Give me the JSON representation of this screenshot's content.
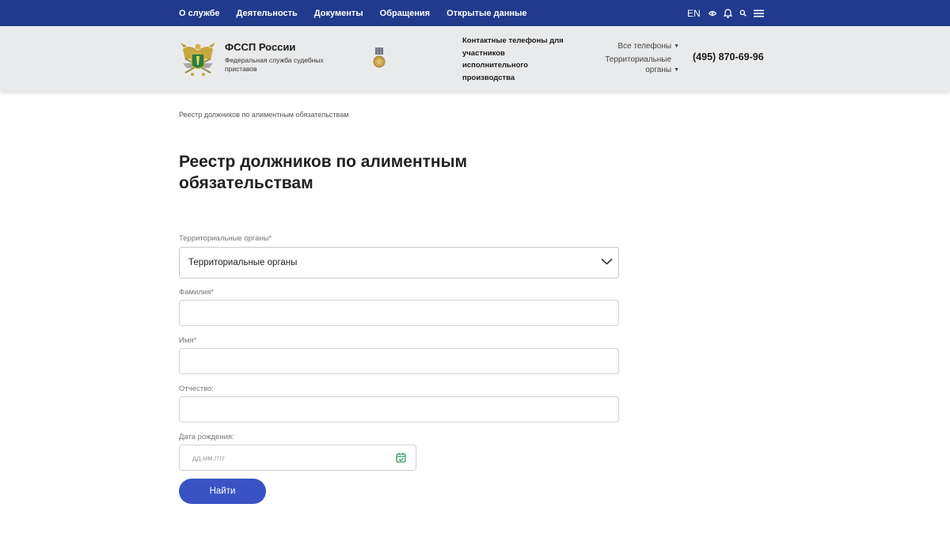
{
  "nav": {
    "items": [
      "О службе",
      "Деятельность",
      "Документы",
      "Обращения",
      "Открытые данные"
    ],
    "lang": "EN",
    "icons": [
      "eye-icon",
      "bell-icon",
      "search-icon",
      "menu-icon"
    ]
  },
  "header": {
    "org_name": "ФССП России",
    "org_subtitle": "Федеральная служба судебных приставов",
    "contacts_title": "Контактные телефоны для участников исполнительного производства",
    "all_phones": "Все телефоны",
    "territorial": "Территориальные органы",
    "phone": "(495) 870-69-96"
  },
  "breadcrumb": "Реестр должников по алиментным обязательствам",
  "page_title": "Реестр должников по алиментным обязательствам",
  "form": {
    "territorial_label": "Территориальные органы*",
    "territorial_value": "Территориальные органы",
    "lastname_label": "Фамилия*",
    "firstname_label": "Имя*",
    "patronymic_label": "Отчество:",
    "birthdate_label": "Дата рождения:",
    "birthdate_placeholder": "дд.мм.гггг",
    "submit_label": "Найти"
  },
  "colors": {
    "topbar": "#213a8c",
    "header_bg": "#e9eaeb",
    "button": "#3a53c4",
    "calendar_icon": "#2e9b5a"
  }
}
